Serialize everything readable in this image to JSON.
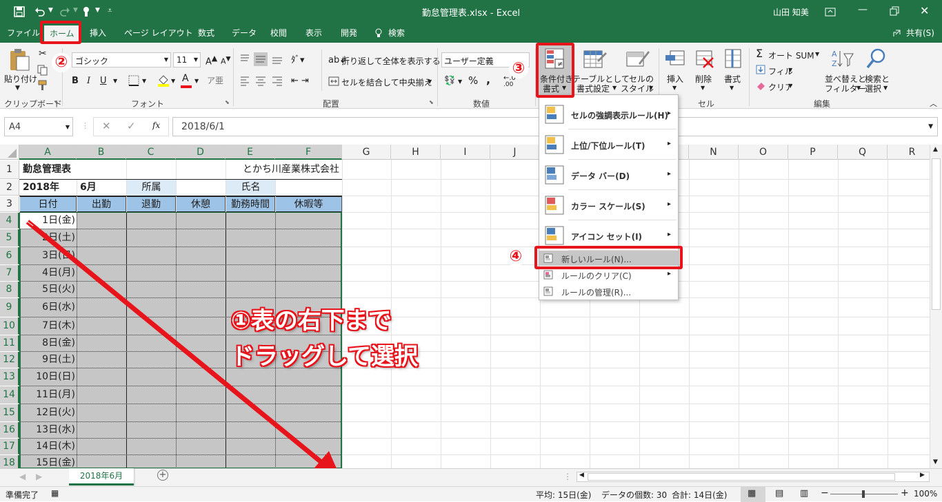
{
  "window": {
    "title": "勤怠管理表.xlsx - Excel",
    "user": "山田 知美",
    "share_label": "共有(S)"
  },
  "tabs": [
    "ファイル",
    "ホーム",
    "挿入",
    "ページ レイアウト",
    "数式",
    "データ",
    "校閲",
    "表示",
    "開発",
    "検索"
  ],
  "ribbon": {
    "paste": "貼り付け",
    "font_name": "ゴシック",
    "font_size": "11",
    "wrap_text": "折り返して全体を表示する",
    "merge_center": "セルを結合して中央揃え",
    "number_format": "ユーザー定義",
    "cond_format": [
      "条件付き",
      "書式"
    ],
    "format_table": [
      "テーブルとして",
      "書式設定"
    ],
    "cell_style": [
      "セルの",
      "スタイル"
    ],
    "insert": "挿入",
    "delete": "削除",
    "format": "書式",
    "autosum": "オート SUM",
    "fill": "フィル",
    "clear": "クリア",
    "sort_filter": [
      "並べ替えと",
      "フィルター"
    ],
    "find_select": [
      "検索と",
      "選択"
    ],
    "groups": {
      "clipboard": "クリップボード",
      "font": "フォント",
      "alignment": "配置",
      "number": "数値",
      "cells": "セル",
      "editing": "編集"
    }
  },
  "formula_bar": {
    "name_box": "A4",
    "fx": "fx",
    "value": "2018/6/1"
  },
  "columns": [
    "A",
    "B",
    "C",
    "D",
    "E",
    "F",
    "G",
    "H",
    "I",
    "J",
    "K",
    "L",
    "M",
    "N",
    "O",
    "P",
    "Q",
    "R"
  ],
  "rows": [
    "1",
    "2",
    "3",
    "4",
    "5",
    "6",
    "7",
    "8",
    "9",
    "10",
    "11",
    "12",
    "13",
    "14",
    "15",
    "16",
    "17",
    "18"
  ],
  "sheet": {
    "title": "勤怠管理表",
    "company": "とかち川産業株式会社",
    "year": "2018年",
    "month": "6月",
    "dept_label": "所属",
    "name_label": "氏名",
    "headers": [
      "日付",
      "出勤",
      "退勤",
      "休憩",
      "勤務時間",
      "休暇等"
    ],
    "dates": [
      "1日(金)",
      "2日(土)",
      "3日(日)",
      "4日(月)",
      "5日(火)",
      "6日(水)",
      "7日(木)",
      "8日(金)",
      "9日(土)",
      "10日(日)",
      "11日(月)",
      "12日(火)",
      "13日(水)",
      "14日(木)",
      "15日(金)"
    ]
  },
  "cf_menu": [
    {
      "label": "セルの強調表示ルール(H)",
      "icon": "highlight-rules-icon",
      "submenu": true
    },
    {
      "label": "上位/下位ルール(T)",
      "icon": "top-bottom-icon",
      "submenu": true
    },
    {
      "label": "データ バー(D)",
      "icon": "data-bar-icon",
      "submenu": true
    },
    {
      "label": "カラー スケール(S)",
      "icon": "color-scale-icon",
      "submenu": true
    },
    {
      "label": "アイコン セット(I)",
      "icon": "icon-set-icon",
      "submenu": true
    },
    {
      "label": "新しいルール(N)...",
      "icon": "new-rule-icon",
      "submenu": false
    },
    {
      "label": "ルールのクリア(C)",
      "icon": "clear-rules-icon",
      "submenu": true
    },
    {
      "label": "ルールの管理(R)...",
      "icon": "manage-rules-icon",
      "submenu": false
    }
  ],
  "annotations": {
    "step1_line1": "①表の右下まで",
    "step1_line2": "ドラッグして選択",
    "step2": "②",
    "step3": "③",
    "step4": "④"
  },
  "sheet_tab": "2018年6月",
  "status": {
    "ready": "準備完了",
    "average": "平均: 15日(金)",
    "count": "データの個数: 30",
    "sum": "合計: 14日(金)",
    "zoom": "100%"
  },
  "colors": {
    "excel_green": "#217346",
    "highlight_red": "#e8141b",
    "header_fill": "#9dc3e6",
    "label_fill": "#ddebf7",
    "selection_fill": "#c6c6c6"
  }
}
